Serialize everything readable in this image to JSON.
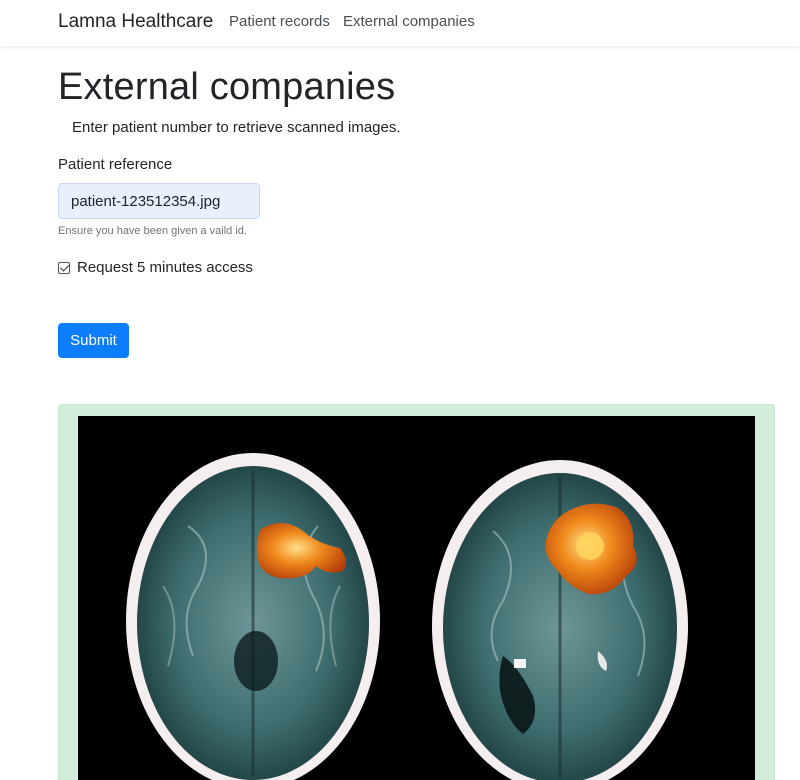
{
  "navbar": {
    "brand": "Lamna Healthcare",
    "links": [
      "Patient records",
      "External companies"
    ]
  },
  "main": {
    "title": "External companies",
    "lead": "Enter patient number to retrieve scanned images.",
    "form": {
      "label": "Patient reference",
      "input_value": "patient-123512354.jpg",
      "help_text": "Ensure you have been given a vaild id.",
      "checkbox_label": "Request 5 minutes access",
      "checkbox_checked": true,
      "submit_label": "Submit"
    }
  },
  "colors": {
    "primary": "#0d7efb",
    "input_bg": "#e8f0fe",
    "panel_bg": "#d4edda",
    "scan_tissue": "#3f6e70",
    "scan_highlight": "#f07a12"
  }
}
